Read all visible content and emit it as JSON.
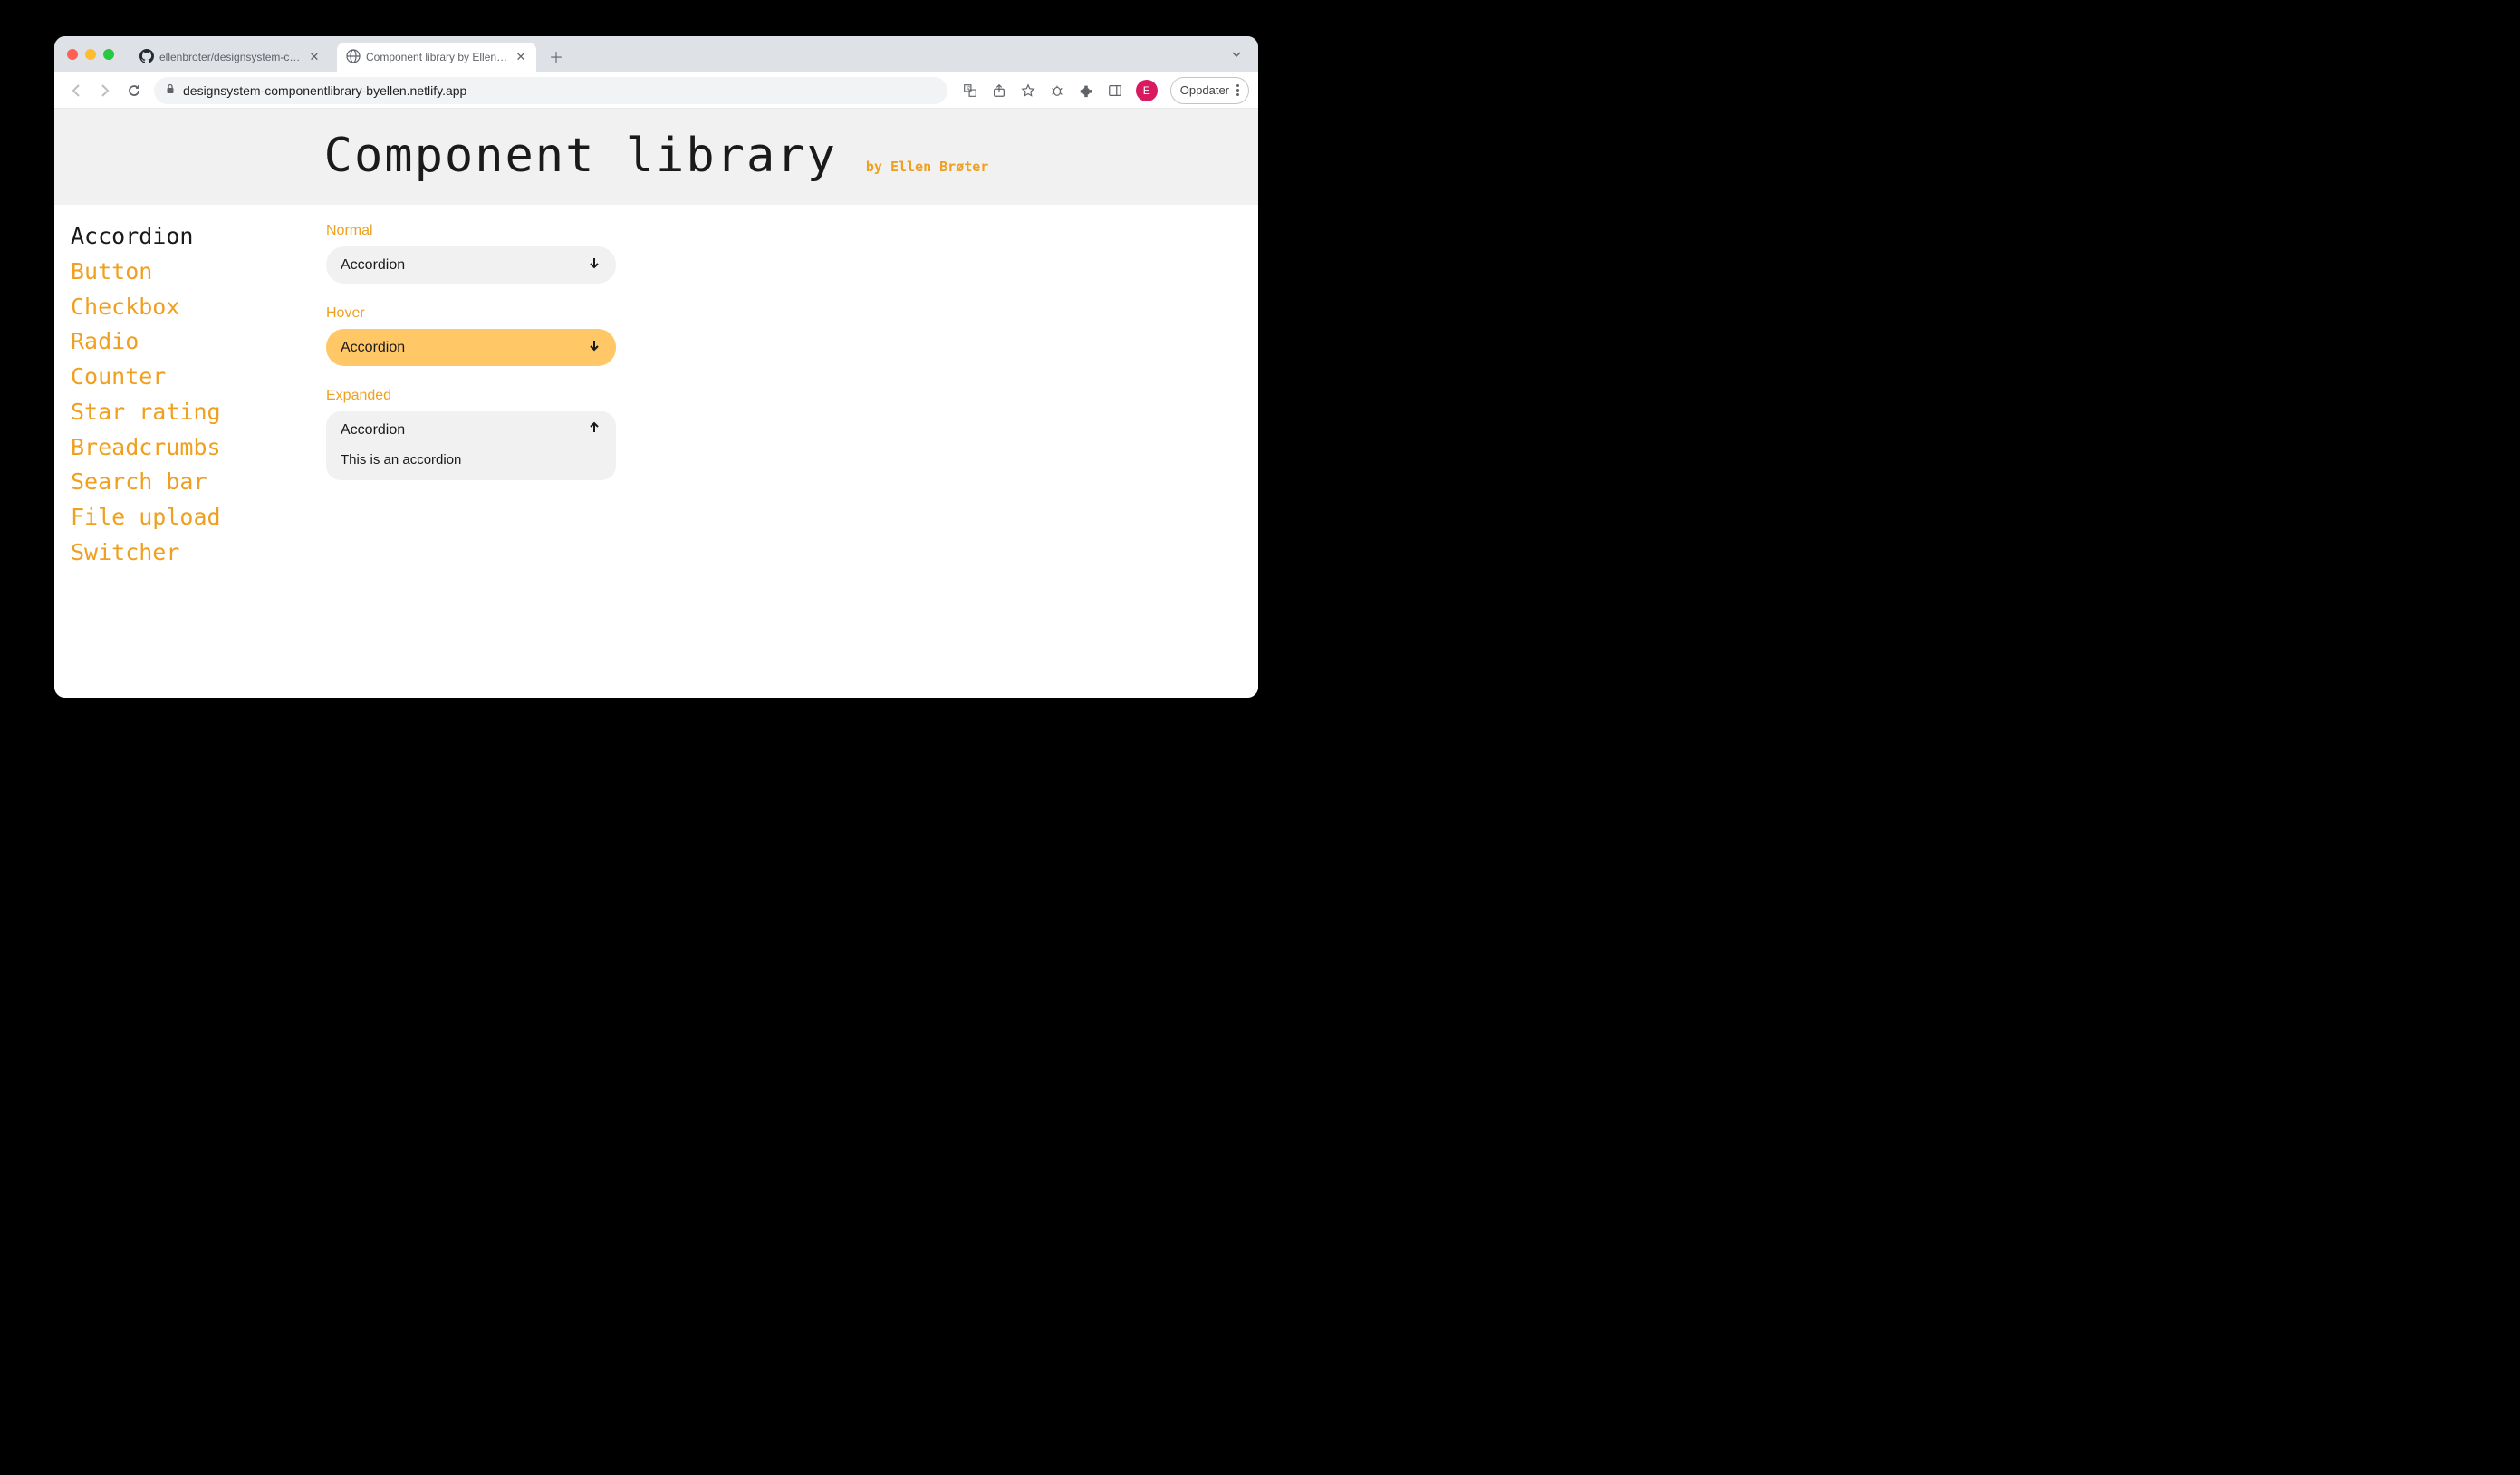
{
  "browser": {
    "tabs": [
      {
        "title": "ellenbroter/designsystem-com",
        "active": false
      },
      {
        "title": "Component library by Ellen Br",
        "active": true
      }
    ],
    "url": "designsystem-componentlibrary-byellen.netlify.app",
    "profile_letter": "E",
    "update_label": "Oppdater"
  },
  "page": {
    "title": "Component library",
    "byline": "by Ellen Brøter"
  },
  "sidebar": {
    "items": [
      {
        "label": "Accordion",
        "active": true
      },
      {
        "label": "Button"
      },
      {
        "label": "Checkbox"
      },
      {
        "label": "Radio"
      },
      {
        "label": "Counter"
      },
      {
        "label": "Star rating"
      },
      {
        "label": "Breadcrumbs"
      },
      {
        "label": "Search bar"
      },
      {
        "label": "File upload"
      },
      {
        "label": "Switcher"
      }
    ]
  },
  "sections": {
    "normal": {
      "label": "Normal",
      "header": "Accordion"
    },
    "hover": {
      "label": "Hover",
      "header": "Accordion"
    },
    "expanded": {
      "label": "Expanded",
      "header": "Accordion",
      "body": "This is an accordion"
    }
  }
}
